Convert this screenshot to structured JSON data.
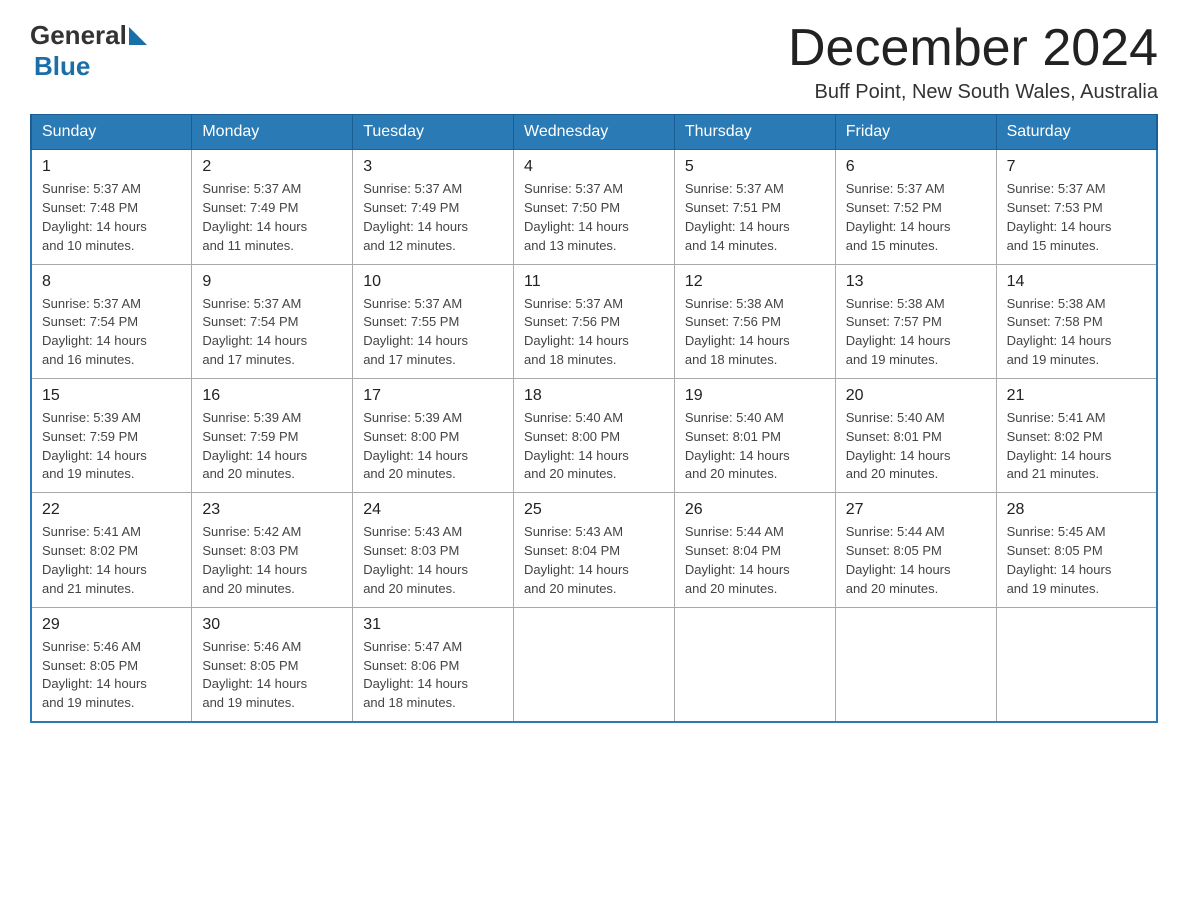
{
  "header": {
    "logo": {
      "general": "General",
      "blue": "Blue",
      "arrow": "▶"
    },
    "month_year": "December 2024",
    "location": "Buff Point, New South Wales, Australia"
  },
  "days_of_week": [
    "Sunday",
    "Monday",
    "Tuesday",
    "Wednesday",
    "Thursday",
    "Friday",
    "Saturday"
  ],
  "weeks": [
    [
      {
        "day": "1",
        "sunrise": "5:37 AM",
        "sunset": "7:48 PM",
        "daylight": "14 hours and 10 minutes."
      },
      {
        "day": "2",
        "sunrise": "5:37 AM",
        "sunset": "7:49 PM",
        "daylight": "14 hours and 11 minutes."
      },
      {
        "day": "3",
        "sunrise": "5:37 AM",
        "sunset": "7:49 PM",
        "daylight": "14 hours and 12 minutes."
      },
      {
        "day": "4",
        "sunrise": "5:37 AM",
        "sunset": "7:50 PM",
        "daylight": "14 hours and 13 minutes."
      },
      {
        "day": "5",
        "sunrise": "5:37 AM",
        "sunset": "7:51 PM",
        "daylight": "14 hours and 14 minutes."
      },
      {
        "day": "6",
        "sunrise": "5:37 AM",
        "sunset": "7:52 PM",
        "daylight": "14 hours and 15 minutes."
      },
      {
        "day": "7",
        "sunrise": "5:37 AM",
        "sunset": "7:53 PM",
        "daylight": "14 hours and 15 minutes."
      }
    ],
    [
      {
        "day": "8",
        "sunrise": "5:37 AM",
        "sunset": "7:54 PM",
        "daylight": "14 hours and 16 minutes."
      },
      {
        "day": "9",
        "sunrise": "5:37 AM",
        "sunset": "7:54 PM",
        "daylight": "14 hours and 17 minutes."
      },
      {
        "day": "10",
        "sunrise": "5:37 AM",
        "sunset": "7:55 PM",
        "daylight": "14 hours and 17 minutes."
      },
      {
        "day": "11",
        "sunrise": "5:37 AM",
        "sunset": "7:56 PM",
        "daylight": "14 hours and 18 minutes."
      },
      {
        "day": "12",
        "sunrise": "5:38 AM",
        "sunset": "7:56 PM",
        "daylight": "14 hours and 18 minutes."
      },
      {
        "day": "13",
        "sunrise": "5:38 AM",
        "sunset": "7:57 PM",
        "daylight": "14 hours and 19 minutes."
      },
      {
        "day": "14",
        "sunrise": "5:38 AM",
        "sunset": "7:58 PM",
        "daylight": "14 hours and 19 minutes."
      }
    ],
    [
      {
        "day": "15",
        "sunrise": "5:39 AM",
        "sunset": "7:59 PM",
        "daylight": "14 hours and 19 minutes."
      },
      {
        "day": "16",
        "sunrise": "5:39 AM",
        "sunset": "7:59 PM",
        "daylight": "14 hours and 20 minutes."
      },
      {
        "day": "17",
        "sunrise": "5:39 AM",
        "sunset": "8:00 PM",
        "daylight": "14 hours and 20 minutes."
      },
      {
        "day": "18",
        "sunrise": "5:40 AM",
        "sunset": "8:00 PM",
        "daylight": "14 hours and 20 minutes."
      },
      {
        "day": "19",
        "sunrise": "5:40 AM",
        "sunset": "8:01 PM",
        "daylight": "14 hours and 20 minutes."
      },
      {
        "day": "20",
        "sunrise": "5:40 AM",
        "sunset": "8:01 PM",
        "daylight": "14 hours and 20 minutes."
      },
      {
        "day": "21",
        "sunrise": "5:41 AM",
        "sunset": "8:02 PM",
        "daylight": "14 hours and 21 minutes."
      }
    ],
    [
      {
        "day": "22",
        "sunrise": "5:41 AM",
        "sunset": "8:02 PM",
        "daylight": "14 hours and 21 minutes."
      },
      {
        "day": "23",
        "sunrise": "5:42 AM",
        "sunset": "8:03 PM",
        "daylight": "14 hours and 20 minutes."
      },
      {
        "day": "24",
        "sunrise": "5:43 AM",
        "sunset": "8:03 PM",
        "daylight": "14 hours and 20 minutes."
      },
      {
        "day": "25",
        "sunrise": "5:43 AM",
        "sunset": "8:04 PM",
        "daylight": "14 hours and 20 minutes."
      },
      {
        "day": "26",
        "sunrise": "5:44 AM",
        "sunset": "8:04 PM",
        "daylight": "14 hours and 20 minutes."
      },
      {
        "day": "27",
        "sunrise": "5:44 AM",
        "sunset": "8:05 PM",
        "daylight": "14 hours and 20 minutes."
      },
      {
        "day": "28",
        "sunrise": "5:45 AM",
        "sunset": "8:05 PM",
        "daylight": "14 hours and 19 minutes."
      }
    ],
    [
      {
        "day": "29",
        "sunrise": "5:46 AM",
        "sunset": "8:05 PM",
        "daylight": "14 hours and 19 minutes."
      },
      {
        "day": "30",
        "sunrise": "5:46 AM",
        "sunset": "8:05 PM",
        "daylight": "14 hours and 19 minutes."
      },
      {
        "day": "31",
        "sunrise": "5:47 AM",
        "sunset": "8:06 PM",
        "daylight": "14 hours and 18 minutes."
      },
      null,
      null,
      null,
      null
    ]
  ],
  "labels": {
    "sunrise": "Sunrise:",
    "sunset": "Sunset:",
    "daylight": "Daylight:"
  }
}
